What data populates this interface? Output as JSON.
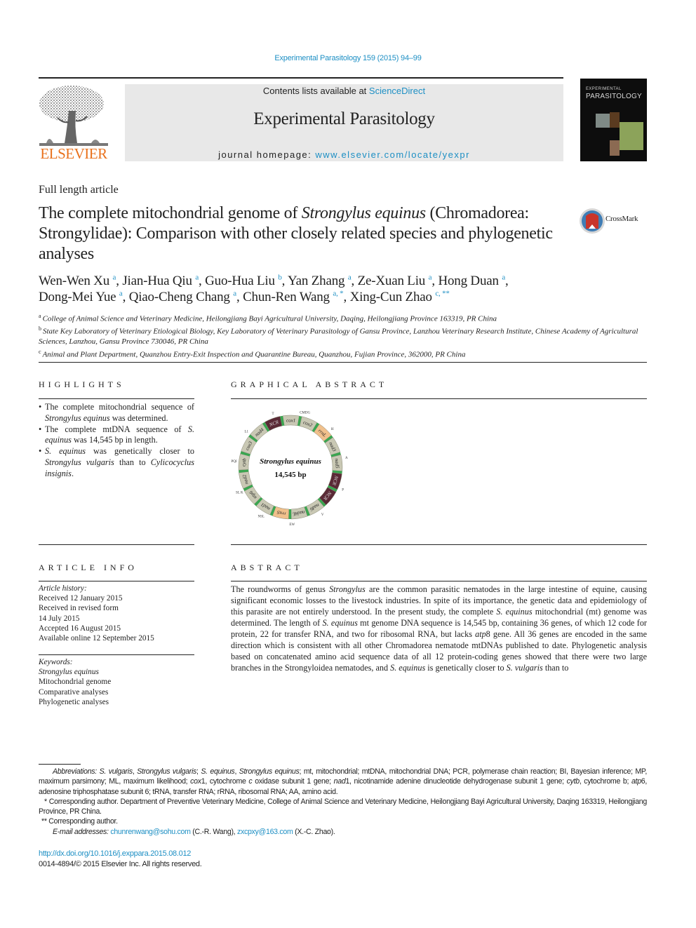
{
  "header": {
    "citation": "Experimental Parasitology 159 (2015) 94–99",
    "contents_prefix": "Contents lists available at ",
    "contents_link": "ScienceDirect",
    "journal_title": "Experimental Parasitology",
    "homepage_prefix": "journal homepage: ",
    "homepage_link": "www.elsevier.com/locate/yexpr",
    "publisher_logo_text": "ELSEVIER",
    "cover_small": "EXPERIMENTAL",
    "cover_title": "PARASITOLOGY"
  },
  "article": {
    "type": "Full length article",
    "title_part1": "The complete mitochondrial genome of ",
    "title_italic": "Strongylus equinus",
    "title_part2": " (Chromadorea: Strongylidae): Comparison with other closely related species and phylogenetic analyses",
    "crossmark_label": "CrossMark"
  },
  "authors": [
    {
      "name": "Wen-Wen Xu",
      "aff": "a",
      "sep": ", "
    },
    {
      "name": "Jian-Hua Qiu",
      "aff": "a",
      "sep": ", "
    },
    {
      "name": "Guo-Hua Liu",
      "aff": "b",
      "sep": ", "
    },
    {
      "name": "Yan Zhang",
      "aff": "a",
      "sep": ", "
    },
    {
      "name": "Ze-Xuan Liu",
      "aff": "a",
      "sep": ", "
    },
    {
      "name": "Hong Duan",
      "aff": "a",
      "sep": ","
    },
    {
      "name": "Dong-Mei Yue",
      "aff": "a",
      "sep": ", "
    },
    {
      "name": "Qiao-Cheng Chang",
      "aff": "a",
      "sep": ", "
    },
    {
      "name": "Chun-Ren Wang",
      "aff": "a, *",
      "sep": ", "
    },
    {
      "name": "Xing-Cun Zhao",
      "aff": "c, **",
      "sep": ""
    }
  ],
  "affiliations": [
    {
      "key": "a",
      "text": "College of Animal Science and Veterinary Medicine, Heilongjiang Bayi Agricultural University, Daqing, Heilongjiang Province 163319, PR China"
    },
    {
      "key": "b",
      "text": "State Key Laboratory of Veterinary Etiological Biology, Key Laboratory of Veterinary Parasitology of Gansu Province, Lanzhou Veterinary Research Institute, Chinese Academy of Agricultural Sciences, Lanzhou, Gansu Province 730046, PR China"
    },
    {
      "key": "c",
      "text": "Animal and Plant Department, Quanzhou Entry-Exit Inspection and Quarantine Bureau, Quanzhou, Fujian Province, 362000, PR China"
    }
  ],
  "highlights": {
    "heading": "HIGHLIGHTS",
    "items": [
      [
        "The complete mitochondrial sequence of ",
        {
          "i": "Strongylus equinus"
        },
        " was determined."
      ],
      [
        "The complete mtDNA sequence of ",
        {
          "i": "S. equinus"
        },
        " was 14,545 bp in length."
      ],
      [
        {
          "i": "S. equinus"
        },
        " was genetically closer to ",
        {
          "i": "Strongylus vulgaris"
        },
        " than to ",
        {
          "i": "Cylicocyclus insignis"
        },
        "."
      ]
    ]
  },
  "graphical_abstract": {
    "heading": "GRAPHICAL ABSTRACT",
    "species": "Strongylus equinus",
    "length": "14,545 bp",
    "genes": [
      {
        "name": "cox1",
        "color": "#c9c8b4"
      },
      {
        "name": "cox2",
        "color": "#c9c8b4"
      },
      {
        "name": "rrnL",
        "color": "#f0c08c"
      },
      {
        "name": "nad3",
        "color": "#c9c8b4"
      },
      {
        "name": "nad5",
        "color": "#c9c8b4"
      },
      {
        "name": "NCR",
        "color": "#5a2a36"
      },
      {
        "name": "NCR",
        "color": "#5a2a36"
      },
      {
        "name": "nad6",
        "color": "#c9c8b4"
      },
      {
        "name": "nad4L",
        "color": "#c9c8b4"
      },
      {
        "name": "rrnS",
        "color": "#f0c08c"
      },
      {
        "name": "nad1",
        "color": "#c9c8b4"
      },
      {
        "name": "atp6",
        "color": "#c9c8b4"
      },
      {
        "name": "nad2",
        "color": "#c9c8b4"
      },
      {
        "name": "cytb",
        "color": "#c9c8b4"
      },
      {
        "name": "cox3",
        "color": "#c9c8b4"
      },
      {
        "name": "nad4",
        "color": "#c9c8b4"
      },
      {
        "name": "NCR",
        "color": "#5a2a36"
      }
    ],
    "trna_labels": [
      "CMDG",
      "H",
      "A",
      "P",
      "V",
      "EW",
      "NSL",
      "SL K",
      "PQI",
      "L1",
      "T"
    ],
    "trna_color": "#3aa650"
  },
  "article_info": {
    "heading": "ARTICLE INFO",
    "history_label": "Article history:",
    "history": [
      "Received 12 January 2015",
      "Received in revised form",
      "14 July 2015",
      "Accepted 16 August 2015",
      "Available online 12 September 2015"
    ],
    "keywords_label": "Keywords:",
    "keywords": [
      {
        "text": "Strongylus equinus",
        "italic": true
      },
      {
        "text": "Mitochondrial genome",
        "italic": false
      },
      {
        "text": "Comparative analyses",
        "italic": false
      },
      {
        "text": "Phylogenetic analyses",
        "italic": false
      }
    ]
  },
  "abstract": {
    "heading": "ABSTRACT",
    "segments": [
      "The roundworms of genus ",
      {
        "i": "Strongylus"
      },
      " are the common parasitic nematodes in the large intestine of equine, causing significant economic losses to the livestock industries. In spite of its importance, the genetic data and epidemiology of this parasite are not entirely understood. In the present study, the complete ",
      {
        "i": "S. equinus"
      },
      " mitochondrial (mt) genome was determined. The length of ",
      {
        "i": "S. equinus"
      },
      " mt genome DNA sequence is 14,545 bp, containing 36 genes, of which 12 code for protein, 22 for transfer RNA, and two for ribosomal RNA, but lacks ",
      {
        "i": "atp"
      },
      "8 gene. All 36 genes are encoded in the same direction which is consistent with all other Chromadorea nematode mtDNAs published to date. Phylogenetic analysis based on concatenated amino acid sequence data of all 12 protein-coding genes showed that there were two large branches in the Strongyloidea nematodes, and ",
      {
        "i": "S. equinus"
      },
      " is genetically closer to ",
      {
        "i": "S. vulgaris"
      },
      " than to"
    ]
  },
  "footnotes": {
    "abbreviations": [
      {
        "i": "Abbreviations:"
      },
      " ",
      {
        "i": "S. vulgaris"
      },
      ", ",
      {
        "i": "Strongylus vulgaris"
      },
      "; ",
      {
        "i": "S. equinus"
      },
      ", ",
      {
        "i": "Strongylus equinus"
      },
      "; mt, mitochondrial; mtDNA, mitochondrial DNA; PCR, polymerase chain reaction; BI, Bayesian inference; MP, maximum parsimony; ML, maximum likelihood; ",
      {
        "i": "cox"
      },
      "1, cytochrome ",
      {
        "i": "c"
      },
      " oxidase subunit 1 gene; ",
      {
        "i": "nad"
      },
      "1, nicotinamide adenine dinucleotide dehydrogenase subunit 1 gene; ",
      {
        "i": "cytb"
      },
      ", cytochrome b; ",
      {
        "i": "atp"
      },
      "6, adenosine triphosphatase subunit 6; tRNA, transfer RNA; rRNA, ribosomal RNA; AA, amino acid."
    ],
    "corresponding1": "* Corresponding author. Department of Preventive Veterinary Medicine, College of Animal Science and Veterinary Medicine, Heilongjiang Bayi Agricultural University, Daqing 163319, Heilongjiang Province, PR China.",
    "corresponding2": "** Corresponding author.",
    "email_label": "E-mail addresses:",
    "email1": "chunrenwang@sohu.com",
    "email1_who": " (C.-R. Wang), ",
    "email2": "zxcpxy@163.com",
    "email2_who": " (X.-C. Zhao).",
    "doi": "http://dx.doi.org/10.1016/j.exppara.2015.08.012",
    "copyright": "0014-4894/© 2015 Elsevier Inc. All rights reserved."
  }
}
